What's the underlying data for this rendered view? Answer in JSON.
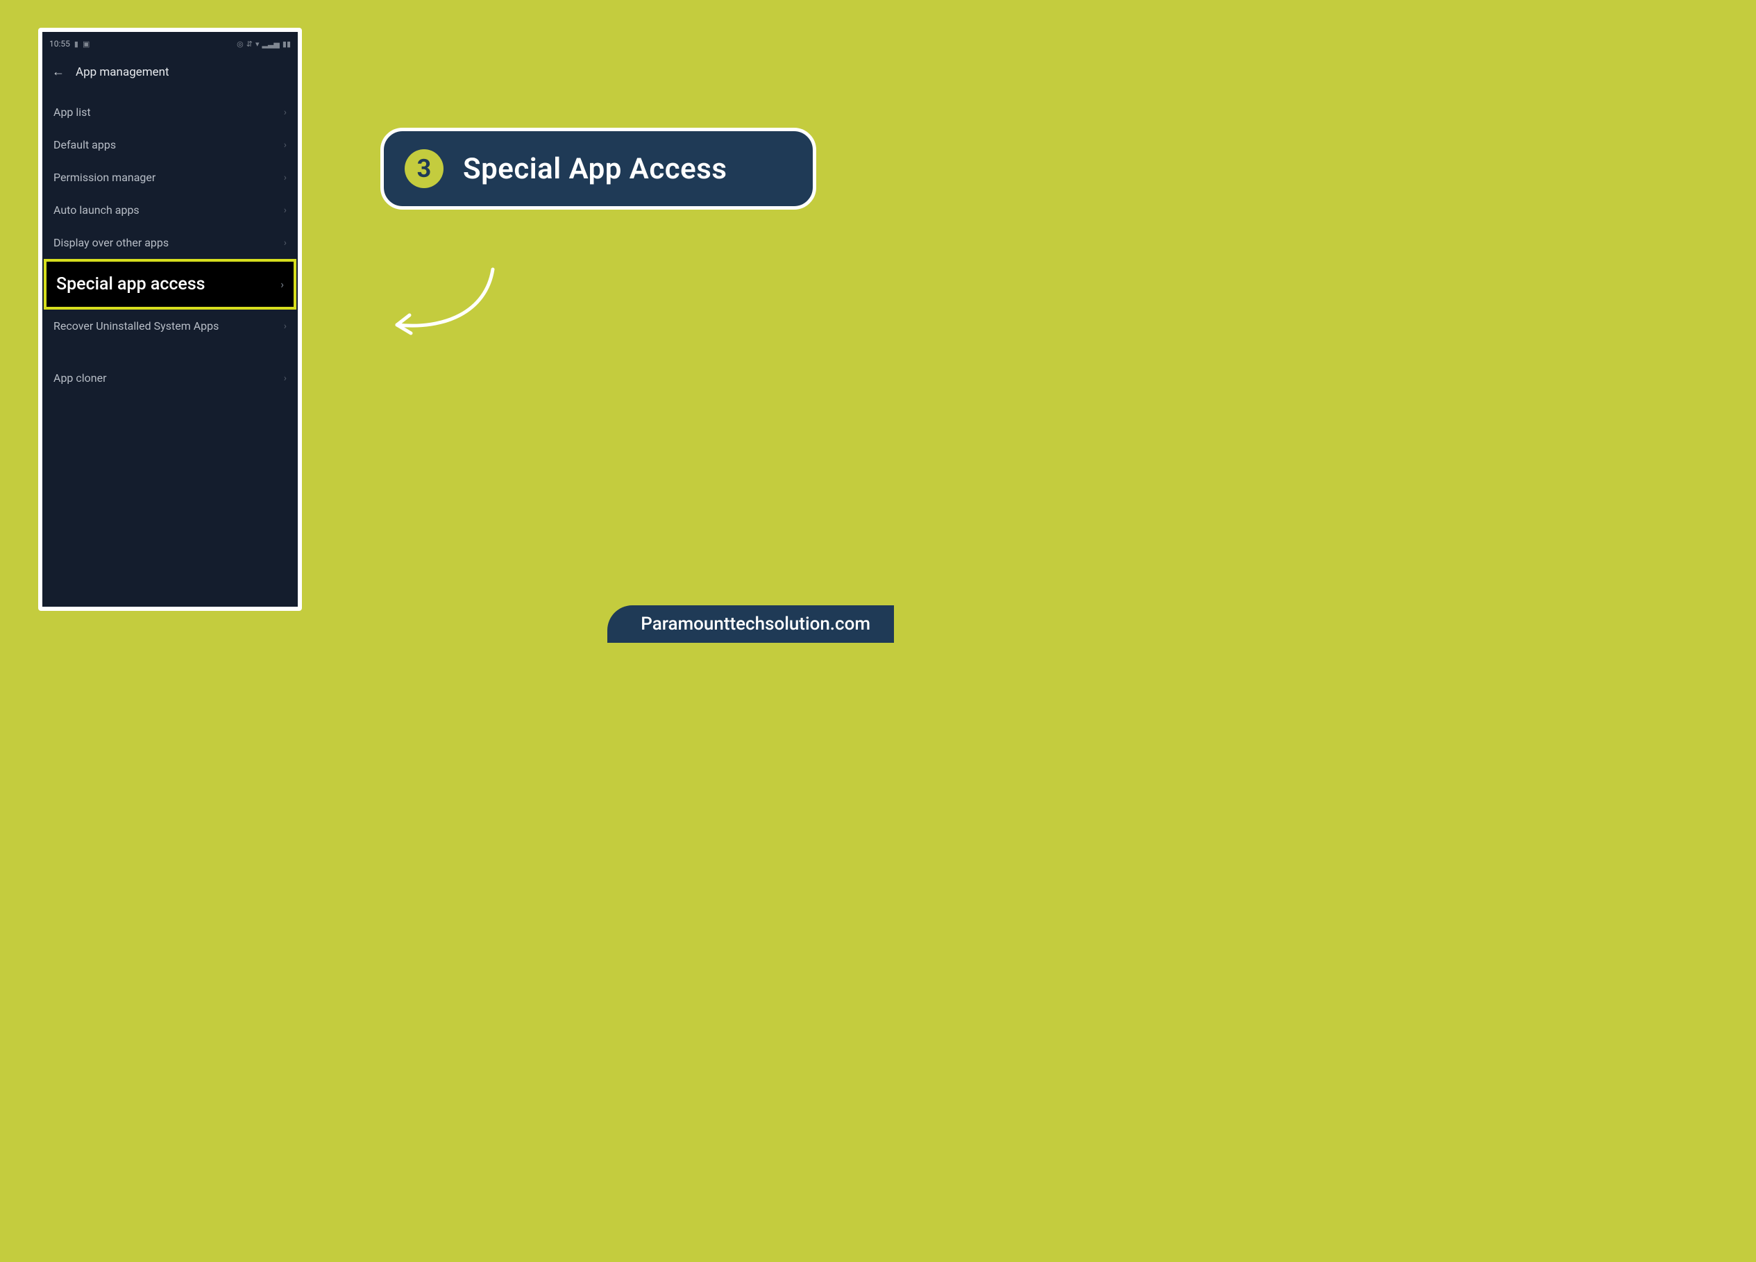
{
  "phone": {
    "status": {
      "time": "10:55",
      "left_icons": [
        "▮",
        "▣"
      ],
      "right_icons": [
        "◎",
        "⇵",
        "▾",
        "▂▃▅",
        "▮▮"
      ]
    },
    "header": {
      "title": "App management"
    },
    "menu": {
      "items": [
        {
          "label": "App list"
        },
        {
          "label": "Default apps"
        },
        {
          "label": "Permission manager"
        },
        {
          "label": "Auto launch apps"
        },
        {
          "label": "Display over other apps"
        }
      ],
      "highlighted": {
        "label": "Special app access"
      },
      "after_highlight": [
        {
          "label": "Recover Uninstalled System Apps"
        }
      ],
      "separated": [
        {
          "label": "App cloner"
        }
      ]
    }
  },
  "callout": {
    "step": "3",
    "text": "Special App Access"
  },
  "footer": {
    "text": "Paramounttechsolution.com"
  }
}
